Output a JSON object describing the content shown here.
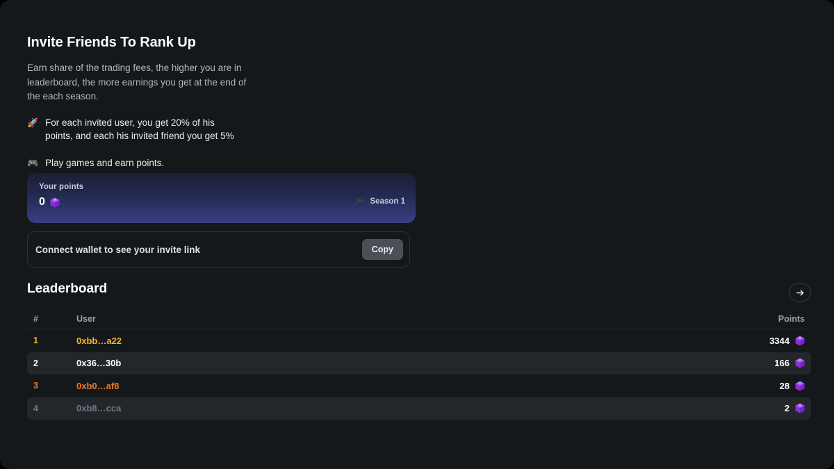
{
  "page": {
    "title": "Invite Friends To Rank Up",
    "description": "Earn share of the trading fees, the higher you are in leaderboard, the more earnings you get at the end of the each season."
  },
  "bullets": [
    {
      "icon": "rocket-icon",
      "glyph": "🚀",
      "text": "For each invited user, you get 20% of his points, and each his invited friend you get 5%"
    },
    {
      "icon": "gamepad-icon",
      "glyph": "🎮",
      "text": "Play games and earn points."
    }
  ],
  "points_banner": {
    "label": "Your points",
    "value": "0",
    "gem_icon": "gem-icon",
    "season_icon": "gamepad-icon",
    "season_label": "Season 1",
    "gradient_from": "#1b1f32",
    "gradient_to": "#3a3f84"
  },
  "invite": {
    "message": "Connect wallet to see your invite link",
    "copy_label": "Copy"
  },
  "leaderboard": {
    "title": "Leaderboard",
    "next_icon": "arrow-right-icon",
    "columns": {
      "rank": "#",
      "user": "User",
      "points": "Points"
    },
    "rows": [
      {
        "rank": "1",
        "user": "0xbb…a22",
        "points": "3344",
        "rank_color": "#f5b528",
        "user_color": "#f5b528",
        "gem_icon": "gem-icon"
      },
      {
        "rank": "2",
        "user": "0x36…30b",
        "points": "166",
        "rank_color": "#ffffff",
        "user_color": "#ffffff",
        "gem_icon": "gem-icon"
      },
      {
        "rank": "3",
        "user": "0xb0…af8",
        "points": "28",
        "rank_color": "#f07a24",
        "user_color": "#f07a24",
        "gem_icon": "gem-icon"
      },
      {
        "rank": "4",
        "user": "0xb8…cca",
        "points": "2",
        "rank_color": "#727a83",
        "user_color": "#727a83",
        "gem_icon": "gem-icon"
      }
    ]
  }
}
